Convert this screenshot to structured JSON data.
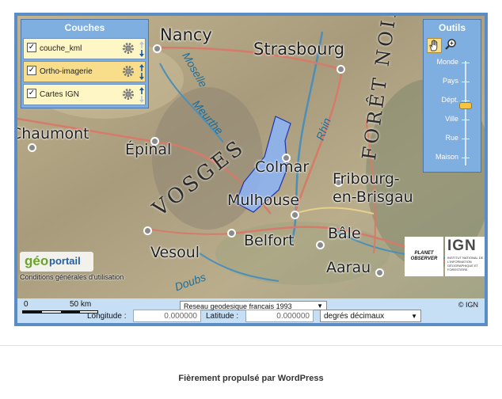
{
  "layers_panel": {
    "title": "Couches",
    "items": [
      {
        "label": "couche_kml",
        "checked": true
      },
      {
        "label": "Ortho-imagerie",
        "checked": true,
        "selected": true
      },
      {
        "label": "Cartes IGN",
        "checked": true
      }
    ]
  },
  "tools_panel": {
    "title": "Outils",
    "zoom_levels": [
      "Monde",
      "Pays",
      "Dépt.",
      "Ville",
      "Rue",
      "Maison"
    ],
    "current_zoom": "Dépt."
  },
  "map": {
    "cities": [
      "Nancy",
      "Strasbourg",
      "Épinal",
      "Colmar",
      "Fribourg-",
      "en-Brisgau",
      "Mulhouse",
      "Belfort",
      "Bâle",
      "Vesoul",
      "Aarau",
      "Chaumont"
    ],
    "regions": [
      "VOSGES",
      "FORÊT NOIRE"
    ],
    "rivers": [
      "Meurthe",
      "Rhin",
      "Moselle",
      "Doubs"
    ]
  },
  "logos": {
    "geoportail": "portail",
    "geoportail_prefix": "géo",
    "conditions_link": "Conditions générales d'utilisation",
    "planet_observer": "PLANET OBSERVER",
    "ign_name": "IGN",
    "ign_subtitle": "INSTITUT NATIONAL DE L'INFORMATION GÉOGRAPHIQUE ET FORESTIÈRE"
  },
  "bottom_bar": {
    "scale_left": "0",
    "scale_right": "50 km",
    "projection": "Reseau geodesique francais 1993",
    "copyright": "© IGN",
    "longitude_label": "Longitude :",
    "longitude_value": "0.000000",
    "latitude_label": "Latitude :",
    "latitude_value": "0.000000",
    "unit": "degrés décimaux"
  },
  "footer": {
    "text": "Fièrement propulsé par WordPress"
  },
  "colors": {
    "panel": "#7faee0",
    "frame": "#5a8cc6",
    "selected_layer": "#f8de8a",
    "kml_polygon": "#8ab4f8"
  }
}
